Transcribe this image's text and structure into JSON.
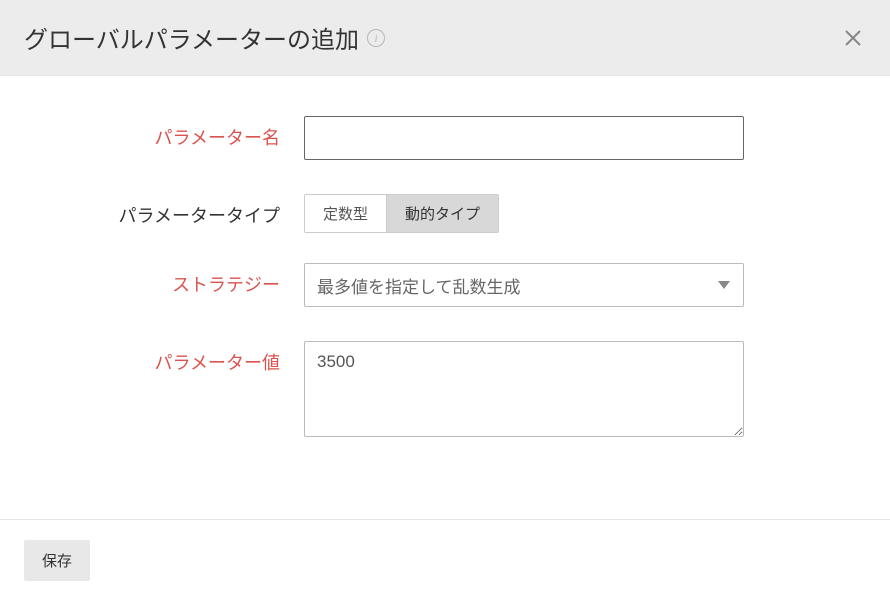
{
  "header": {
    "title": "グローバルパラメーターの追加"
  },
  "form": {
    "parameter_name": {
      "label": "パラメーター名",
      "value": ""
    },
    "parameter_type": {
      "label": "パラメータータイプ",
      "options": {
        "constant": "定数型",
        "dynamic": "動的タイプ"
      }
    },
    "strategy": {
      "label": "ストラテジー",
      "selected": "最多値を指定して乱数生成"
    },
    "parameter_value": {
      "label": "パラメーター値",
      "value": "3500"
    }
  },
  "footer": {
    "save_label": "保存"
  }
}
